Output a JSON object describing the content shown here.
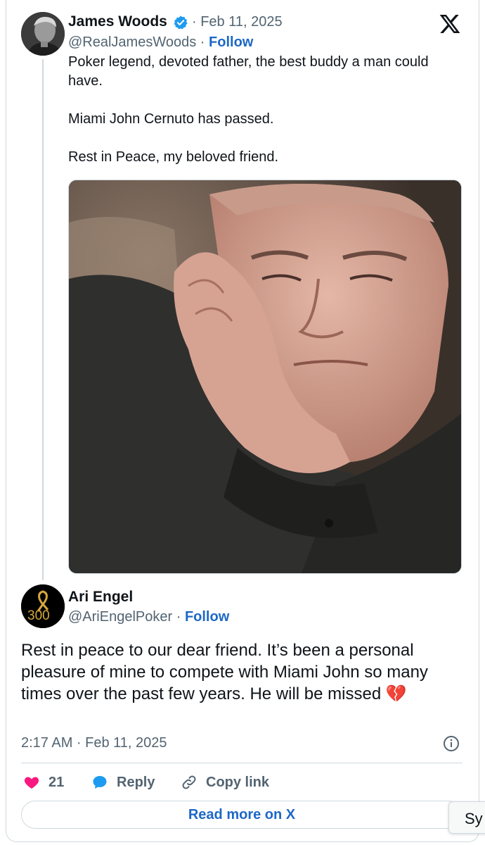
{
  "parent_tweet": {
    "author_name": "James Woods",
    "date": "· Feb 11, 2025",
    "handle": "@RealJamesWoods",
    "separator": " · ",
    "follow_label": "Follow",
    "text": "Poker legend, devoted father, the best buddy a man could have.\n\nMiami John Cernuto has passed.\n\nRest in Peace, my beloved friend."
  },
  "reply_tweet": {
    "author_name": "Ari Engel",
    "handle": "@AriEngelPoker",
    "separator": " · ",
    "follow_label": "Follow",
    "avatar_badge": "300",
    "text": "Rest in peace to our dear friend. It’s been a personal pleasure of mine to compete with Miami John so many times over the past few years. He will be missed",
    "emoji": "💔",
    "timestamp": "2:17 AM · Feb 11, 2025"
  },
  "actions": {
    "like_count": "21",
    "reply_label": "Reply",
    "copy_link_label": "Copy link"
  },
  "read_more_label": "Read more on X",
  "side_tab_label": "Sy",
  "colors": {
    "accent": "#1d68c6",
    "like": "#f91880",
    "reply_icon": "#1d9bf0",
    "verified": "#1d9bf0",
    "border": "#cfd9de"
  }
}
